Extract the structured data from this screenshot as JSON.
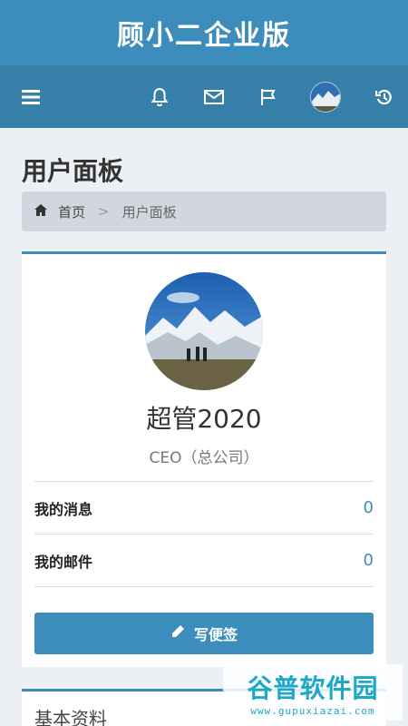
{
  "app": {
    "title": "顾小二企业版"
  },
  "navbar": {
    "menu_icon": "hamburger-icon",
    "icons": [
      "bell-icon",
      "envelope-icon",
      "flag-icon",
      "user-avatar",
      "history-icon"
    ]
  },
  "page": {
    "title": "用户面板"
  },
  "breadcrumb": {
    "home": "首页",
    "separator": ">",
    "current": "用户面板"
  },
  "profile": {
    "name": "超管2020",
    "role": "CEO（总公司）",
    "items": [
      {
        "label": "我的消息",
        "count": "0"
      },
      {
        "label": "我的邮件",
        "count": "0"
      }
    ],
    "action_label": "写便签"
  },
  "section2": {
    "title": "基本资料"
  },
  "watermark": {
    "main": "谷普软件园",
    "url": "www.gupuxiazai.com"
  },
  "colors": {
    "primary": "#3c8dbc",
    "navbar": "#367fa9",
    "background": "#ecf0f5"
  }
}
